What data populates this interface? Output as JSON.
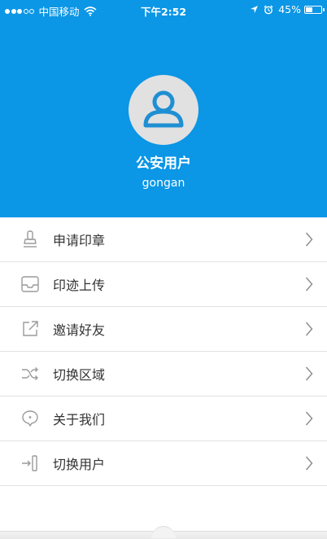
{
  "status_bar": {
    "carrier": "中国移动",
    "time": "下午2:52",
    "battery_percent": "45%",
    "battery_level": 0.45,
    "signal_strength_of_5": 3
  },
  "profile": {
    "name": "公安用户",
    "username": "gongan",
    "avatar_icon": "user-icon"
  },
  "menu": {
    "items": [
      {
        "label": "申请印章",
        "icon": "stamp-icon"
      },
      {
        "label": "印迹上传",
        "icon": "inbox-upload-icon"
      },
      {
        "label": "邀请好友",
        "icon": "share-external-icon"
      },
      {
        "label": "切换区域",
        "icon": "shuffle-icon"
      },
      {
        "label": "关于我们",
        "icon": "chat-bubble-icon"
      },
      {
        "label": "切换用户",
        "icon": "switch-user-icon"
      }
    ]
  },
  "colors": {
    "header_bg": "#0b96e6",
    "icon_gray": "#9a9a9a",
    "text": "#333333"
  }
}
